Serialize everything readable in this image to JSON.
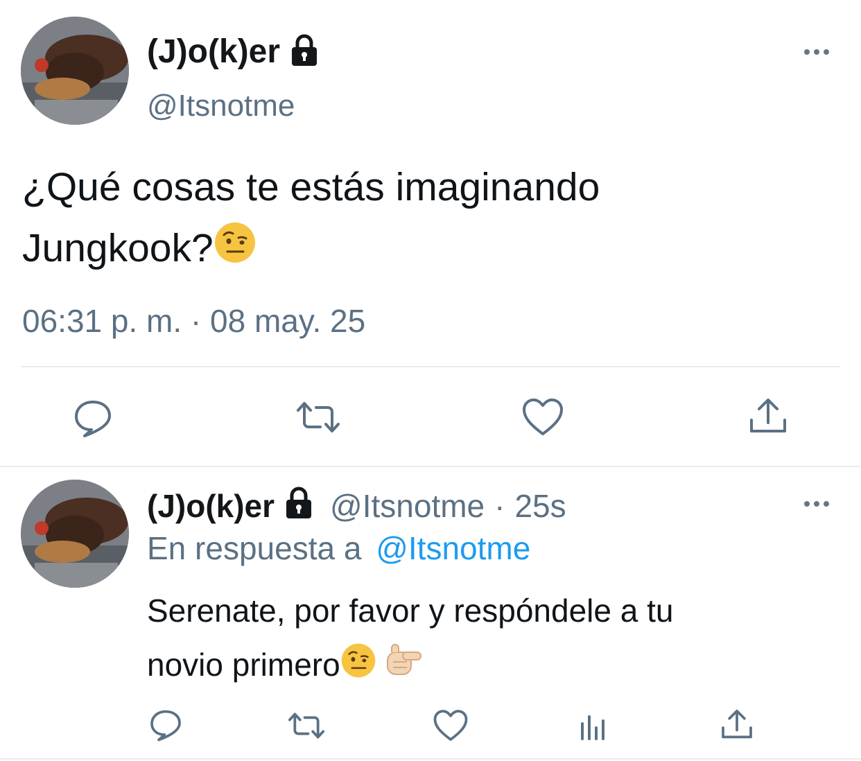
{
  "main_tweet": {
    "display_name": "(J)o(k)er",
    "handle": "@Itsnotme",
    "text_line1": "¿Qué cosas te estás imaginando",
    "text_line2": "Jungkook?",
    "timestamp": "06:31 p. m. · 08 may. 25",
    "actions": [
      "reply-icon",
      "retweet-icon",
      "like-icon",
      "share-icon"
    ]
  },
  "reply_tweet": {
    "display_name": "(J)o(k)er",
    "handle": "@Itsnotme",
    "separator": "·",
    "age": "25s",
    "in_reply_to_label": "En respuesta a",
    "in_reply_to_handle": "@Itsnotme",
    "text_line1": "Serenate, por favor y respóndele a tu",
    "text_line2": "novio primero",
    "actions": [
      "reply-icon",
      "retweet-icon",
      "like-icon",
      "analytics-icon",
      "share-icon"
    ]
  },
  "colors": {
    "text": "#0f1419",
    "muted": "#5b7083",
    "link": "#1d9bf0",
    "icon": "#5b7083",
    "divider": "#e6ecf0"
  }
}
